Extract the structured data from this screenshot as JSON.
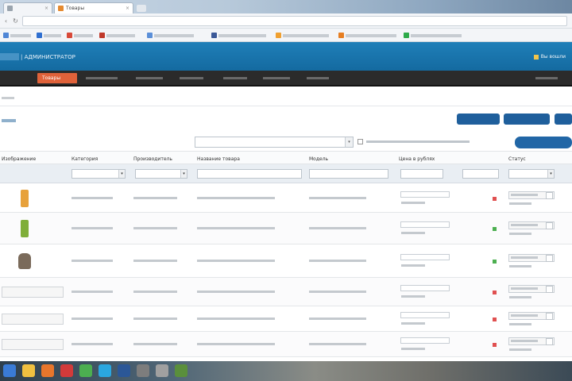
{
  "browser": {
    "tabs": [
      {
        "title": "",
        "color": "#9aa4ae"
      },
      {
        "title": "Товары",
        "color": "#e58a30"
      }
    ],
    "url": "",
    "bookmarks": [
      {
        "label": "",
        "color": "#4f86d6"
      },
      {
        "label": "",
        "color": "#2f6fd0"
      },
      {
        "label": "",
        "color": "#d84a3a"
      },
      {
        "label": "",
        "color": "#c0392b"
      },
      {
        "label": "",
        "color": "#5b8fd8"
      },
      {
        "label": "",
        "color": "#3b5998"
      },
      {
        "label": "",
        "color": "#f0a030"
      },
      {
        "label": "",
        "color": "#e67e22"
      },
      {
        "label": "",
        "color": "#2eaa4a"
      }
    ]
  },
  "admin": {
    "title": "| АДМИНИСТРАТОР",
    "user": "Вы вошли"
  },
  "nav": [
    {
      "label": "",
      "active": false
    },
    {
      "label": "Товары",
      "active": true
    },
    {
      "label": "",
      "active": false
    },
    {
      "label": "",
      "active": false
    },
    {
      "label": "",
      "active": false
    },
    {
      "label": "",
      "active": false
    },
    {
      "label": "",
      "active": false
    },
    {
      "label": "",
      "active": false
    },
    {
      "label": "",
      "active": false
    }
  ],
  "breadcrumb": "",
  "page_heading": "",
  "top_buttons": [
    "",
    "",
    ""
  ],
  "filter": {
    "checkbox_label": "",
    "apply_label": ""
  },
  "columns": [
    "Изображение",
    "Категория",
    "Производитель",
    "Название товара",
    "Модель",
    "Цена в рублях",
    "",
    "Статус",
    ""
  ],
  "rows": [
    {
      "image": "bottle",
      "image_color": "#e7a13b",
      "category": "",
      "manufacturer": "",
      "name": "",
      "model": "",
      "price": "",
      "price_link": "",
      "available": "red",
      "status": "",
      "status_link": ""
    },
    {
      "image": "bottle",
      "image_color": "#7fae3a",
      "category": "",
      "manufacturer": "",
      "name": "",
      "model": "",
      "price": "",
      "price_link": "",
      "available": "green",
      "status": "",
      "status_link": ""
    },
    {
      "image": "jar",
      "image_color": "#7a6a5a",
      "category": "",
      "manufacturer": "",
      "name": "",
      "model": "",
      "price": "",
      "price_link": "",
      "available": "green",
      "status": "",
      "status_link": ""
    },
    {
      "image": "text",
      "image_text": "",
      "category": "",
      "manufacturer": "",
      "name": "",
      "model": "",
      "price": "",
      "price_link": "",
      "available": "red",
      "status": "",
      "status_link": ""
    },
    {
      "image": "text",
      "image_text": "",
      "category": "",
      "manufacturer": "",
      "name": "",
      "model": "",
      "price": "",
      "price_link": "",
      "available": "red",
      "status": "",
      "status_link": ""
    },
    {
      "image": "text",
      "image_text": "",
      "category": "",
      "manufacturer": "",
      "name": "",
      "model": "",
      "price": "",
      "price_link": "",
      "available": "red",
      "status": "",
      "status_link": ""
    }
  ],
  "colors": {
    "header_blue": "#1a76ae",
    "nav_dark": "#2b2b2b",
    "active_orange": "#e0623a",
    "button_blue": "#1f5f9c",
    "link_blue": "#2b6ea3"
  },
  "taskbar_icons": [
    {
      "name": "start-orb-icon",
      "color": "#3a7bd5"
    },
    {
      "name": "explorer-icon",
      "color": "#f0c040"
    },
    {
      "name": "firefox-icon",
      "color": "#e8762b"
    },
    {
      "name": "opera-icon",
      "color": "#d23a3a"
    },
    {
      "name": "chrome-icon",
      "color": "#4caf50"
    },
    {
      "name": "skype-icon",
      "color": "#2aa7e0"
    },
    {
      "name": "word-icon",
      "color": "#2b5797"
    },
    {
      "name": "app-icon",
      "color": "#7d7d7d"
    },
    {
      "name": "app-icon-2",
      "color": "#a0a0a0"
    },
    {
      "name": "app-icon-3",
      "color": "#5a8f3c"
    }
  ],
  "clock": ""
}
